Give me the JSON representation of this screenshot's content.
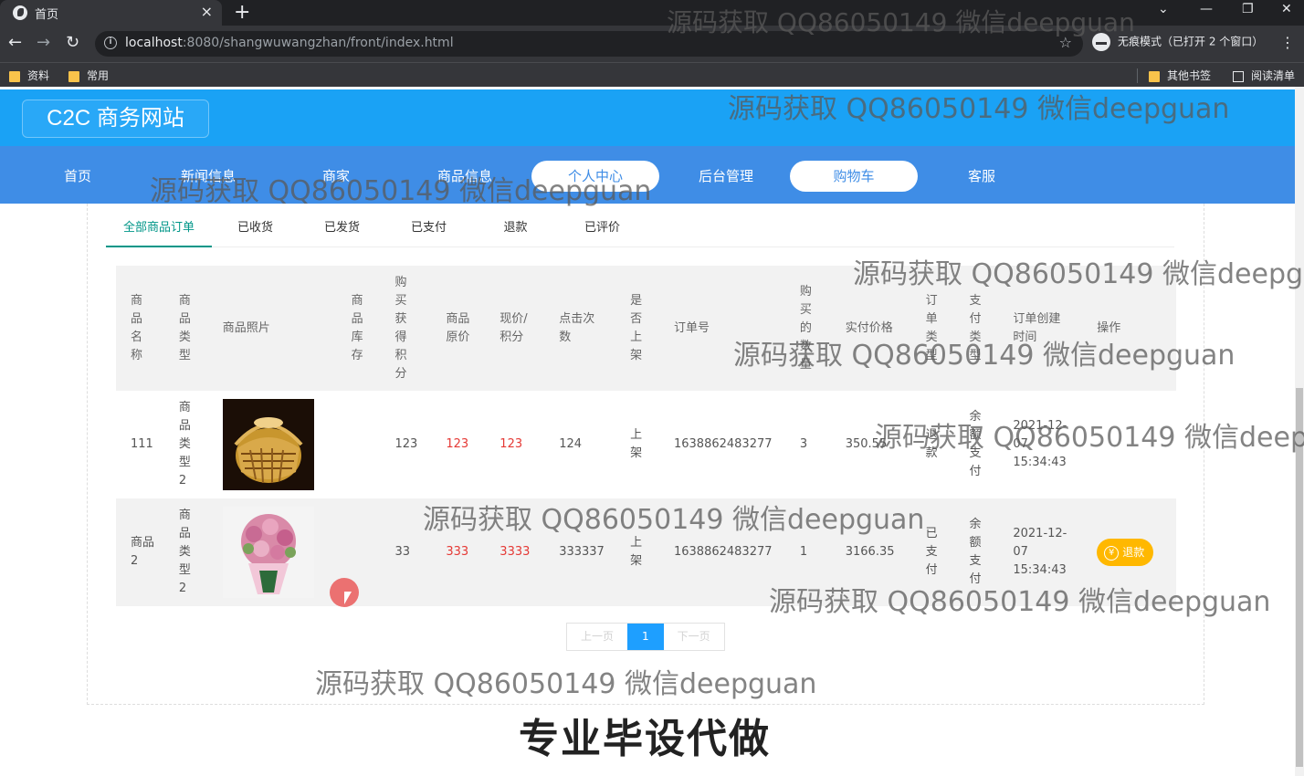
{
  "browser": {
    "tab_title": "首页",
    "url_host": "localhost",
    "url_rest": ":8080/shangwuwangzhan/front/index.html",
    "incognito_label": "无痕模式（已打开 2 个窗口）",
    "bookmarks": [
      "资料",
      "常用"
    ],
    "other_bookmarks": "其他书签",
    "reading_list": "阅读清单"
  },
  "site": {
    "title": "C2C 商务网站",
    "nav": [
      "首页",
      "新闻信息",
      "商家",
      "商品信息",
      "个人中心",
      "后台管理",
      "购物车",
      "客服"
    ]
  },
  "order_tabs": [
    "全部商品订单",
    "已收货",
    "已发货",
    "已支付",
    "退款",
    "已评价"
  ],
  "table": {
    "headers": [
      "商品名称",
      "商品类型",
      "商品照片",
      "商品库存",
      "购买获得积分",
      "商品原价",
      "现价/积分",
      "点击次数",
      "是否上架",
      "订单号",
      "购买的数量",
      "实付价格",
      "订单类型",
      "支付类型",
      "订单创建时间",
      "操作"
    ],
    "rows": [
      {
        "name": "111",
        "type": "商品类型2",
        "photo": "basket",
        "stock": "",
        "points": "123",
        "orig_price": "123",
        "cur_price": "123",
        "clicks": "124",
        "on_shelf": "上架",
        "order_no": "1638862483277",
        "qty": "3",
        "paid": "350.55",
        "order_type": "退款",
        "pay_type": "余额支付",
        "created_1": "2021-12-",
        "created_2": "07",
        "created_3": "15:34:43",
        "action": ""
      },
      {
        "name": "商品2",
        "type": "商品类型2",
        "photo": "flowers",
        "stock": "",
        "points": "33",
        "orig_price": "333",
        "cur_price": "3333",
        "clicks": "333337",
        "on_shelf": "上架",
        "order_no": "1638862483277",
        "qty": "1",
        "paid": "3166.35",
        "order_type": "已支付",
        "pay_type": "余额支付",
        "created_1": "2021-12-",
        "created_2": "07",
        "created_3": "15:34:43",
        "action": "退款"
      }
    ]
  },
  "pager": {
    "prev": "上一页",
    "current": "1",
    "next": "下一页"
  },
  "banner": "专业毕设代做",
  "watermark": "源码获取 QQ86050149 微信deepguan",
  "colors": {
    "header": "#1aa2f5",
    "navbar": "#3f8de6",
    "active_tab": "#009688",
    "refund": "#ffb800",
    "pager_current": "#1e9fff"
  }
}
